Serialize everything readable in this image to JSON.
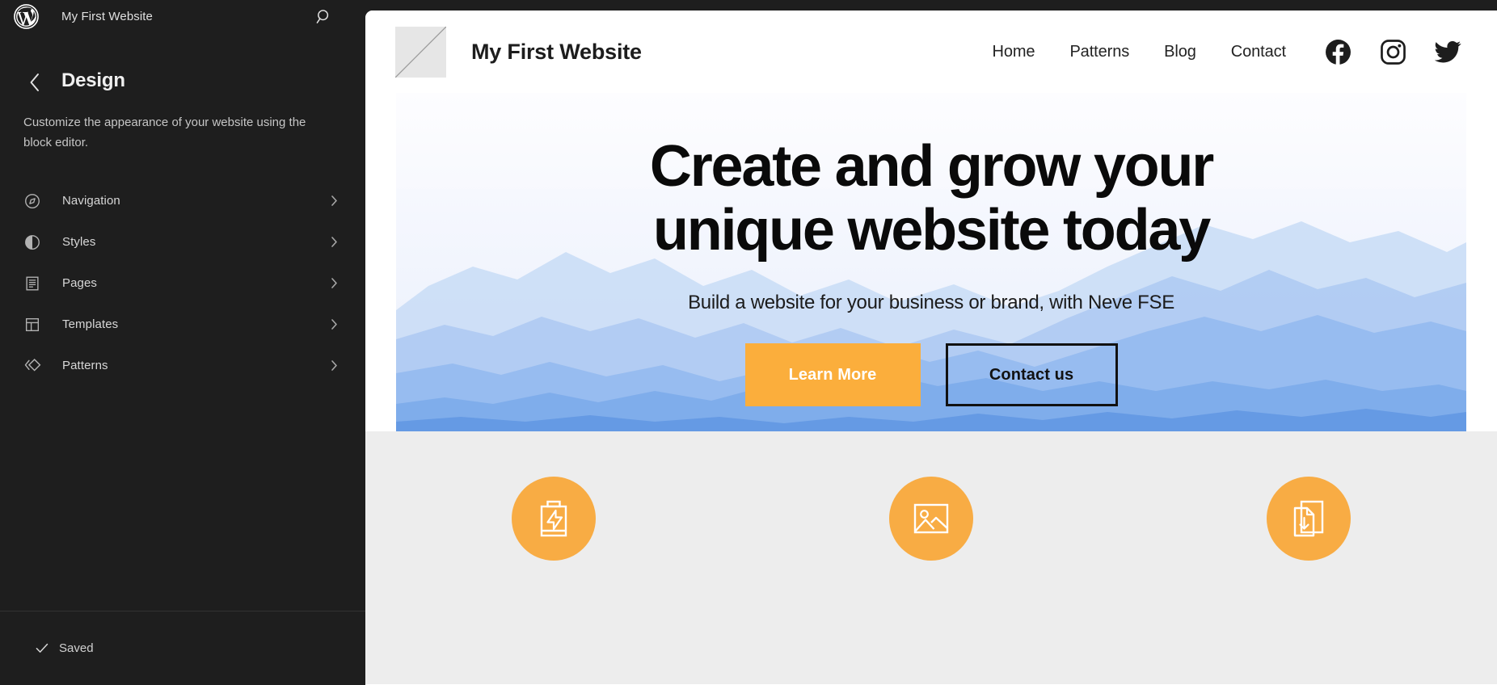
{
  "editor": {
    "hub": {
      "logo_icon": "wordpress-logo-icon",
      "site_title": "My First Website",
      "search_icon": "search-icon"
    },
    "panel": {
      "back_icon": "chevron-left-icon",
      "title": "Design",
      "description": "Customize the appearance of your website using the block editor."
    },
    "nav_items": [
      {
        "label": "Navigation",
        "icon": "compass-icon",
        "arrow": "chevron-right-icon"
      },
      {
        "label": "Styles",
        "icon": "contrast-circle-icon",
        "arrow": "chevron-right-icon"
      },
      {
        "label": "Pages",
        "icon": "document-lines-icon",
        "arrow": "chevron-right-icon"
      },
      {
        "label": "Templates",
        "icon": "layout-panel-icon",
        "arrow": "chevron-right-icon"
      },
      {
        "label": "Patterns",
        "icon": "patterns-diamond-icon",
        "arrow": "chevron-right-icon"
      }
    ],
    "footer": {
      "check_icon": "checkmark-icon",
      "status": "Saved"
    }
  },
  "preview": {
    "header": {
      "logo_icon": "placeholder-image-icon",
      "site_name": "My First Website",
      "menu": [
        {
          "label": "Home"
        },
        {
          "label": "Patterns"
        },
        {
          "label": "Blog"
        },
        {
          "label": "Contact"
        }
      ],
      "socials": [
        {
          "name": "facebook-icon"
        },
        {
          "name": "instagram-icon"
        },
        {
          "name": "twitter-icon"
        }
      ]
    },
    "hero": {
      "heading": "Create and grow your unique website today",
      "subheading": "Build a website for your business or brand, with Neve FSE",
      "primary_button": "Learn More",
      "secondary_button": "Contact us"
    },
    "features": [
      {
        "icon": "battery-charge-icon"
      },
      {
        "icon": "image-placeholder-icon"
      },
      {
        "icon": "document-download-icon"
      }
    ]
  },
  "colors": {
    "editor_bg": "#1e1e1e",
    "accent_orange": "#fbae3c",
    "feature_orange": "#f8ac44",
    "features_bg": "#ededed",
    "hero_text": "#0a0a0a"
  }
}
